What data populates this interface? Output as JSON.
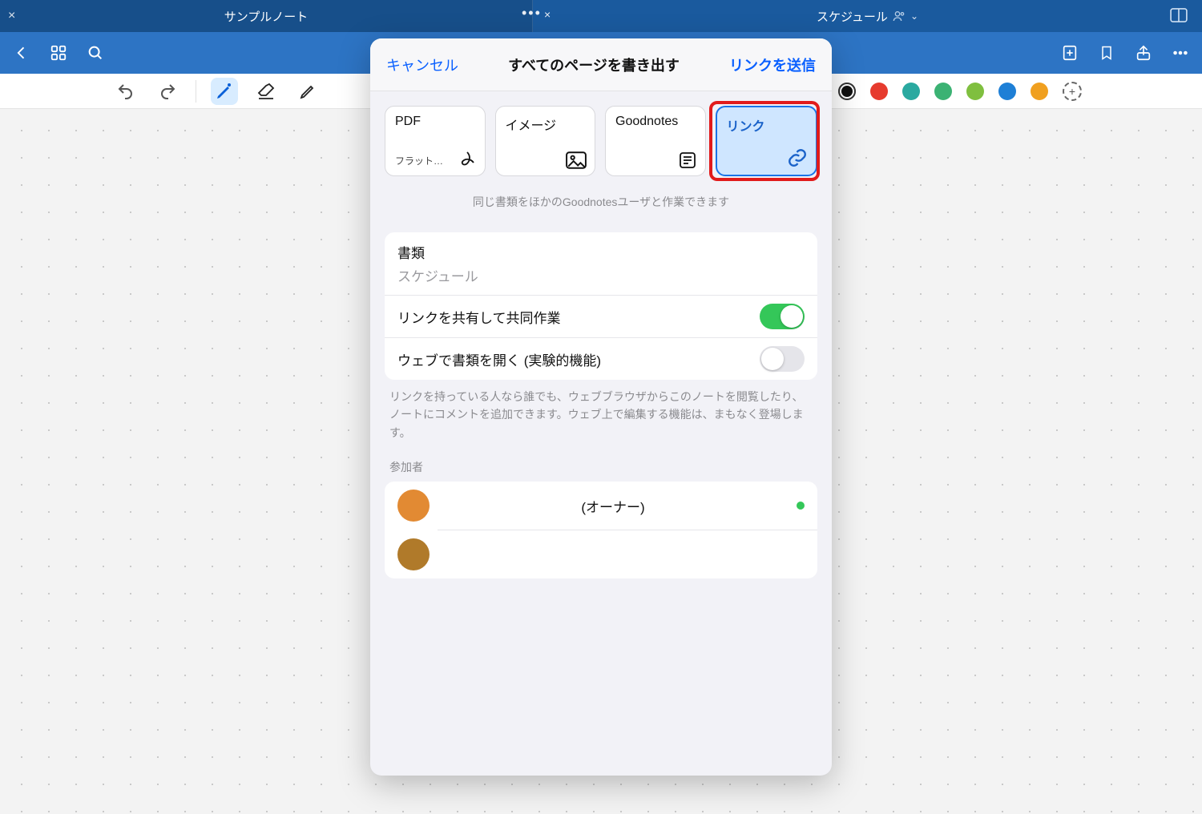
{
  "tabs": {
    "left": "サンプルノート",
    "right": "スケジュール"
  },
  "modal": {
    "cancel": "キャンセル",
    "title": "すべてのページを書き出す",
    "send": "リンクを送信",
    "formats": {
      "pdf": {
        "title": "PDF",
        "sub": "フラット化…"
      },
      "image": {
        "title": "イメージ"
      },
      "goodnotes": {
        "title": "Goodnotes"
      },
      "link": {
        "title": "リンク"
      }
    },
    "hint": "同じ書類をほかのGoodnotesユーザと作業できます",
    "doc_section_label": "書類",
    "doc_name": "スケジュール",
    "share_label": "リンクを共有して共同作業",
    "share_on": true,
    "web_label": "ウェブで書類を開く (実験的機能)",
    "web_on": false,
    "footnote": "リンクを持っている人なら誰でも、ウェブブラウザからこのノートを閲覧したり、ノートにコメントを追加できます。ウェブ上で編集する機能は、まもなく登場します。",
    "participants_label": "参加者",
    "participants": [
      {
        "name": "(オーナー)",
        "color": "#e28a33",
        "online": true
      },
      {
        "name": "",
        "color": "#b07a2a",
        "online": false
      }
    ]
  },
  "colors": [
    "#111111",
    "#e63b2e",
    "#2aa9a0",
    "#3bb273",
    "#7fbf3f",
    "#1e7fd6",
    "#f0a020"
  ]
}
